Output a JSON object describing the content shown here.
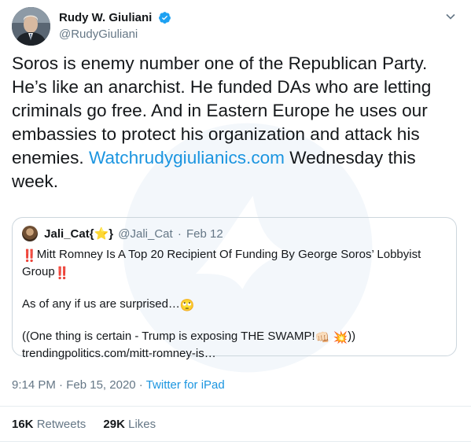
{
  "author": {
    "display_name": "Rudy W. Giuliani",
    "handle": "@RudyGiuliani"
  },
  "tweet": {
    "text_before_link": "Soros is enemy number one of the Republican Party. He’s like an anarchist. He funded DAs who are letting criminals go free. And in Eastern Europe he uses our embassies to protect his organization and attack his enemies. ",
    "link_text": "Watchrudygiulianics.com",
    "text_after_link": " Wednesday this week."
  },
  "quoted_tweet": {
    "display_name_prefix": "Jali_Cat{",
    "display_name_star": "⭐",
    "display_name_suffix": "}",
    "handle": "@Jali_Cat",
    "separator": "·",
    "date": "Feb 12",
    "line1_emoji": "‼️",
    "line1_text": "Mitt Romney Is A Top 20 Recipient Of Funding By George Soros’ Lobbyist Group",
    "line1_emoji_end": "‼️",
    "line2_text": "As of any if us are surprised…",
    "line2_emoji": "🙄",
    "line3_text": "((One thing is certain - Trump is exposing THE SWAMP!",
    "line3_emoji1": "👊🏻",
    "line3_emoji2": "💥",
    "line3_end": "))",
    "line4_text": "trendingpolitics.com/mitt-romney-is…"
  },
  "meta": {
    "time": "9:14 PM",
    "separator": " · ",
    "date": "Feb 15, 2020",
    "separator2": " · ",
    "source": "Twitter for iPad"
  },
  "stats": {
    "retweets_count": "16K",
    "retweets_label": "Retweets",
    "likes_count": "29K",
    "likes_label": "Likes"
  },
  "colors": {
    "link": "#1b95e0",
    "secondary": "#657786",
    "border": "#ccd6dd",
    "verified": "#1da1f2"
  }
}
